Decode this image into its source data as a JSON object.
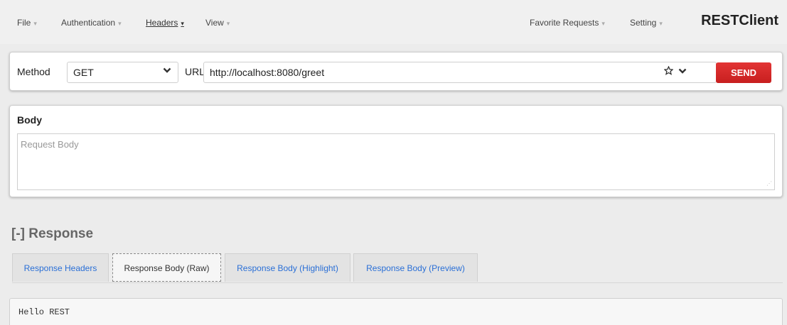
{
  "menu": {
    "items": [
      {
        "label": "File",
        "caret": "▾"
      },
      {
        "label": "Authentication",
        "caret": "▾"
      },
      {
        "label": "Headers",
        "caret": "▾"
      },
      {
        "label": "View",
        "caret": "▾"
      }
    ],
    "right_items": [
      {
        "label": "Favorite Requests",
        "caret": "▾"
      },
      {
        "label": "Setting",
        "caret": "▾"
      }
    ],
    "brand": "RESTClient"
  },
  "request": {
    "method_label": "Method",
    "method_value": "GET",
    "url_label": "URL",
    "url_value": "http://localhost:8080/greet",
    "send_label": "SEND",
    "icons": {
      "method_dropdown": "chevron-down-icon",
      "favorite": "star-icon",
      "url_dropdown": "chevron-down-icon"
    }
  },
  "body": {
    "title": "Body",
    "placeholder": "Request Body"
  },
  "response": {
    "title": "[-] Response",
    "tabs": [
      {
        "label": "Response Headers",
        "active": false
      },
      {
        "label": "Response Body (Raw)",
        "active": true
      },
      {
        "label": "Response Body (Highlight)",
        "active": false
      },
      {
        "label": "Response Body (Preview)",
        "active": false
      }
    ],
    "body_text": "Hello REST"
  },
  "colors": {
    "send": "#d42a2a",
    "tab_link": "#2a6fd6",
    "background": "#ececec"
  }
}
